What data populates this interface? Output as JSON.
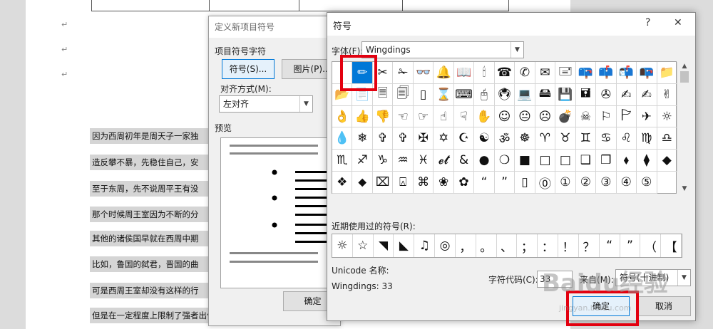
{
  "document": {
    "lines": [
      "因为西周初年是周天子一家独",
      "造反攀不暴，先稳住自己，安",
      "至于东周，先不说周平王有没",
      "那个时候周王室因为不断的分",
      "其他的诸侯国早就在西周中期",
      "比如，鲁国的弑君，晋国的曲",
      "可是西周王室却没有这样的行",
      "但是在一定程度上限制了强者出位，遏制了周王室的发展"
    ],
    "return_mark": "↵"
  },
  "bullet_dialog": {
    "title": "定义新项目符号",
    "group_label": "项目符号字符",
    "symbol_button": "符号(S)...",
    "picture_button": "图片(P)...",
    "align_label": "对齐方式(M):",
    "align_value": "左对齐",
    "preview_label": "预览",
    "ok_button": "确定"
  },
  "symbol_dialog": {
    "title": "符号",
    "help": "?",
    "close": "✕",
    "font_label": "字体(F):",
    "font_value": "Wingdings",
    "symbols": [
      "",
      "✏",
      "✂",
      "✁",
      "👓",
      "🔔",
      "📖",
      "🕯",
      "☎",
      "✆",
      "✉",
      "🖃",
      "📪",
      "📫",
      "📬",
      "📭",
      "📁",
      "📂",
      "📄",
      "🗏",
      "🗐",
      "▯",
      "⌛",
      "⌨",
      "🖰",
      "🖲",
      "💻",
      "🖴",
      "💾",
      "🖬",
      "✇",
      "✍",
      "✍",
      "✌",
      "👌",
      "👍",
      "👎",
      "☜",
      "☞",
      "☝",
      "☟",
      "✋",
      "☺",
      "😐",
      "☹",
      "💣",
      "☠",
      "⚐",
      "🏱",
      "✈",
      "☼",
      "💧",
      "❄",
      "✞",
      "✞",
      "✠",
      "✡",
      "☪",
      "☯",
      "ॐ",
      "☸",
      "♈",
      "♉",
      "♊",
      "♋",
      "♌",
      "♍",
      "♎",
      "♏",
      "♐",
      "♑",
      "♒",
      "♓",
      "𝓮𝓽",
      "&",
      "●",
      "❍",
      "■",
      "□",
      "□",
      "❑",
      "❒",
      "⬧",
      "⧫",
      "◆",
      "❖",
      "⬥",
      "⌧",
      "⍓",
      "⌘",
      "❀",
      "✿",
      "“",
      "”",
      "▯",
      "⓪",
      "①",
      "②",
      "③",
      "④",
      "⑤"
    ],
    "recent_label": "近期使用过的符号(R):",
    "recent": [
      "☼",
      "☆",
      "◥",
      "◣",
      "♫",
      "◎",
      "，",
      "。",
      "、",
      "；",
      "：",
      "！",
      "？",
      "“",
      "”",
      "（",
      "【"
    ],
    "unicode_label": "Unicode 名称:",
    "char_name": "Wingdings: 33",
    "code_label": "字符代码(C):",
    "code_value": "33",
    "from_label": "来自(M):",
    "from_value": "符号(十进制)",
    "insert_button": "确定",
    "cancel_button": "取消"
  },
  "watermark": {
    "main": "Baidu经验",
    "sub": "jingyan.baidu.com"
  },
  "colors": {
    "highlight": "#e3000f",
    "selection": "#0078d7"
  }
}
